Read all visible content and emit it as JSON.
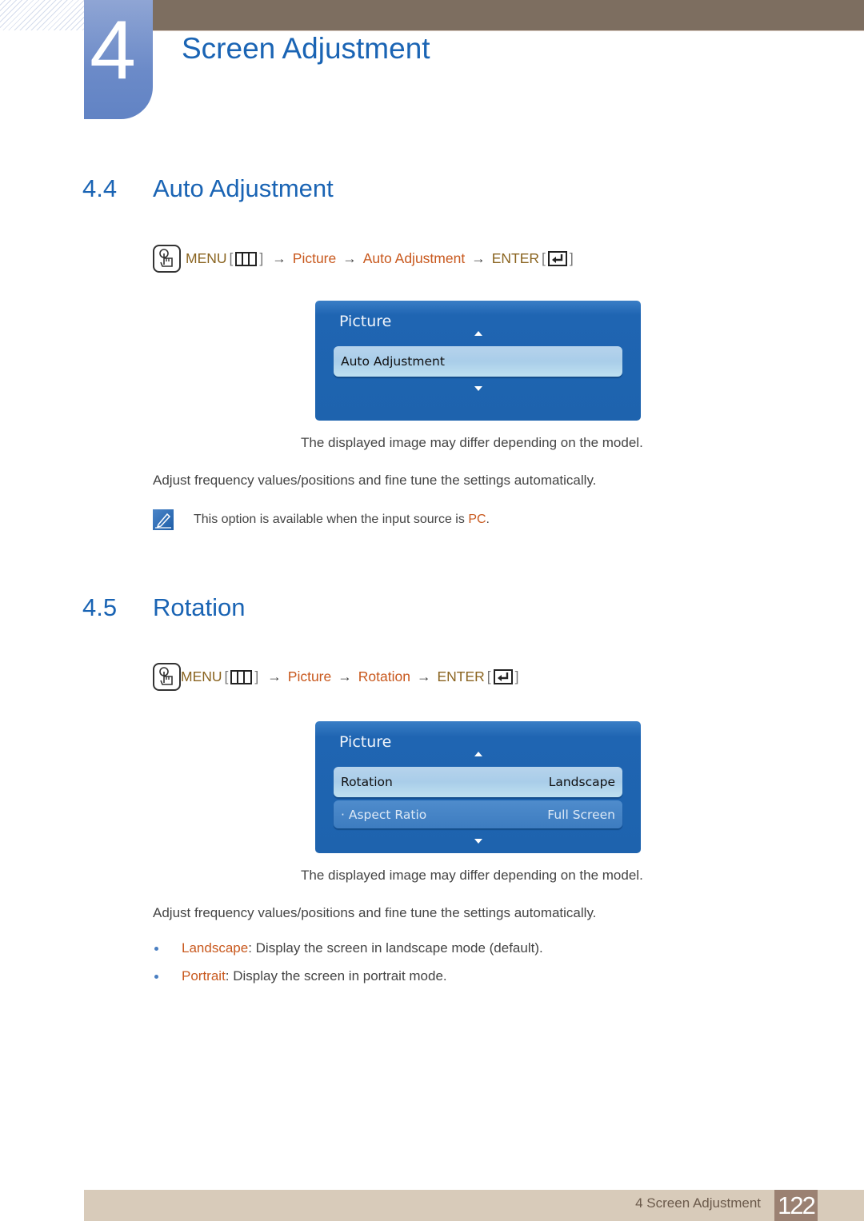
{
  "header": {
    "chapter_number": "4",
    "chapter_title": "Screen Adjustment"
  },
  "sections": [
    {
      "number": "4.4",
      "title": "Auto Adjustment",
      "menu_path": {
        "menu": "MENU",
        "steps": [
          "Picture",
          "Auto Adjustment"
        ],
        "enter": "ENTER",
        "arrow": "→",
        "bracket_open": "[",
        "bracket_close": "]"
      },
      "osd": {
        "title": "Picture",
        "items": [
          {
            "label": "Auto Adjustment",
            "value": "",
            "selected": true
          }
        ]
      },
      "caption": "The displayed image may differ depending on the model.",
      "description": "Adjust frequency values/positions and fine tune the settings automatically.",
      "note": {
        "text": "This option is available when the input source is ",
        "highlight": "PC",
        "suffix": "."
      }
    },
    {
      "number": "4.5",
      "title": "Rotation",
      "menu_path": {
        "menu": "MENU",
        "steps": [
          "Picture",
          "Rotation"
        ],
        "enter": "ENTER",
        "arrow": "→",
        "bracket_open": "[",
        "bracket_close": "]"
      },
      "osd": {
        "title": "Picture",
        "items": [
          {
            "label": "Rotation",
            "value": "Landscape",
            "selected": true
          },
          {
            "label": "· Aspect Ratio",
            "value": "Full Screen",
            "selected": false
          }
        ]
      },
      "caption": "The displayed image may differ depending on the model.",
      "description": "Adjust frequency values/positions and fine tune the settings automatically.",
      "bullets": [
        {
          "term": "Landscape",
          "text": ": Display the screen in landscape mode (default)."
        },
        {
          "term": "Portrait",
          "text": ": Display the screen in portrait mode."
        }
      ]
    }
  ],
  "footer": {
    "chapter_label": "4 Screen Adjustment",
    "page_number": "122"
  },
  "colors": {
    "heading_blue": "#1a64b4",
    "accent_orange": "#c8581d",
    "menu_brown": "#8a6420",
    "top_bar": "#7d6e60",
    "footer_bar": "#d8cbba",
    "footer_page": "#9b8172"
  }
}
